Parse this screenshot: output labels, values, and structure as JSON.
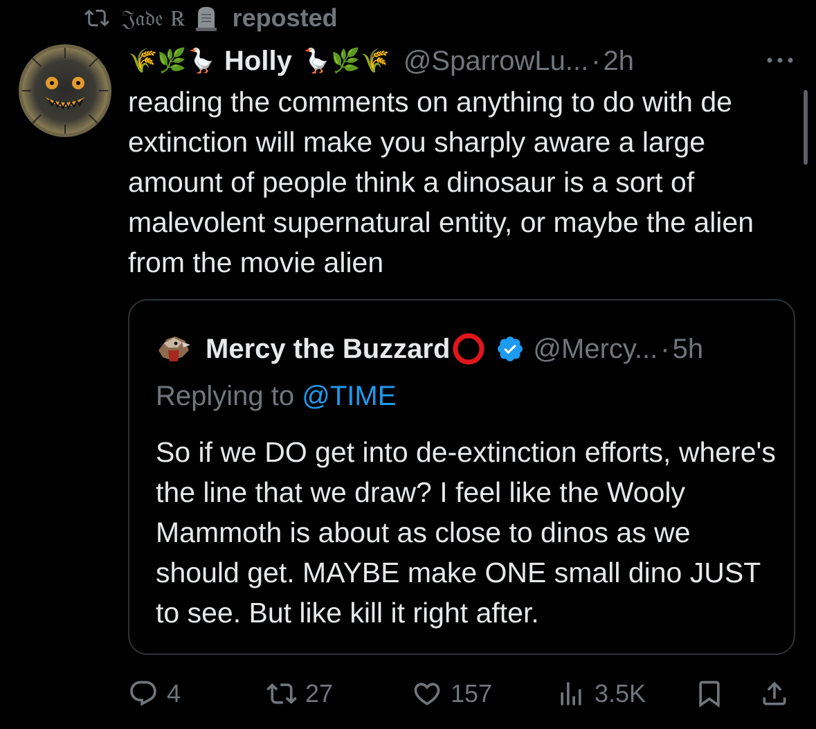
{
  "repost": {
    "reposter_name": "𝔍𝔞𝔡𝔢 ℞",
    "label": "reposted",
    "icon": "repost-icon",
    "emoji_icon": "headstone-icon"
  },
  "post": {
    "name_prefix_emoji": "🌾🌿🪿",
    "display_name": "Holly",
    "name_suffix_emoji": "🪿🌿🌾",
    "handle": "@SparrowLu...",
    "separator": "·",
    "time": "2h",
    "text": "reading the comments on anything to do with de extinction will make you sharply aware a large amount of people think a dinosaur is a sort of malevolent supernatural entity, or maybe the alien from the movie alien"
  },
  "quote": {
    "display_name": "Mercy the Buzzard",
    "handle": "@Mercy...",
    "separator": "·",
    "time": "5h",
    "replying_prefix": "Replying to ",
    "replying_to": "@TIME",
    "text": "So if we DO get into de-extinction efforts, where's the line that we draw? I feel like the Wooly Mammoth is about as close to dinos as we should get. MAYBE make ONE small dino JUST to see. But like kill it right after."
  },
  "actions": {
    "replies": "4",
    "reposts": "27",
    "likes": "157",
    "views": "3.5K"
  },
  "colors": {
    "background": "#000000",
    "text": "#e7e9ea",
    "muted": "#71767b",
    "link": "#1d9bf0",
    "border": "#2f3336"
  }
}
